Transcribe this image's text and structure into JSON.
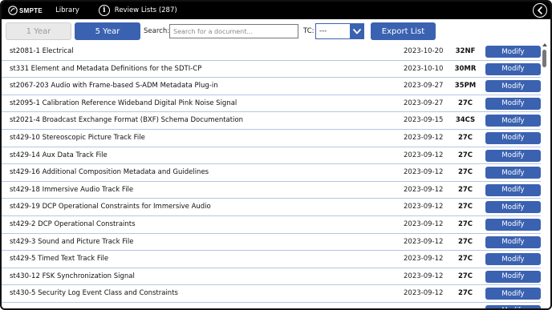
{
  "topbar": {
    "logo_text": "SMPTE",
    "library_label": "Library",
    "info_icon_glyph": "i",
    "review_lists_label": "Review Lists (287)"
  },
  "toolbar": {
    "one_year_label": "1 Year",
    "five_year_label": "5 Year",
    "search_label": "Search:",
    "search_placeholder": "Search for a document...",
    "tc_label": "TC:",
    "tc_value": "---",
    "export_label": "Export List"
  },
  "colors": {
    "accent": "#3b62b1",
    "topbar": "#000000",
    "row_divider": "#b7c6e3"
  },
  "icons": {
    "logo": "smpte-logo-icon",
    "info": "info-icon",
    "back": "chevron-left-icon",
    "dropdown": "chevron-down-icon"
  },
  "documents": [
    {
      "title": "st2081-1 Electrical",
      "date": "2023-10-20",
      "tc": "32NF",
      "action": "Modify"
    },
    {
      "title": "st331 Element and Metadata Definitions for the SDTI-CP",
      "date": "2023-10-10",
      "tc": "30MR",
      "action": "Modify"
    },
    {
      "title": "st2067-203 Audio with Frame-based S-ADM Metadata Plug-in",
      "date": "2023-09-27",
      "tc": "35PM",
      "action": "Modify"
    },
    {
      "title": "st2095-1 Calibration Reference Wideband Digital Pink Noise Signal",
      "date": "2023-09-27",
      "tc": "27C",
      "action": "Modify"
    },
    {
      "title": "st2021-4 Broadcast Exchange Format (BXF) Schema Documentation",
      "date": "2023-09-15",
      "tc": "34CS",
      "action": "Modify"
    },
    {
      "title": "st429-10 Stereoscopic Picture Track File",
      "date": "2023-09-12",
      "tc": "27C",
      "action": "Modify"
    },
    {
      "title": "st429-14 Aux Data Track File",
      "date": "2023-09-12",
      "tc": "27C",
      "action": "Modify"
    },
    {
      "title": "st429-16 Additional Composition Metadata and Guidelines",
      "date": "2023-09-12",
      "tc": "27C",
      "action": "Modify"
    },
    {
      "title": "st429-18 Immersive Audio Track File",
      "date": "2023-09-12",
      "tc": "27C",
      "action": "Modify"
    },
    {
      "title": "st429-19 DCP Operational Constraints for Immersive Audio",
      "date": "2023-09-12",
      "tc": "27C",
      "action": "Modify"
    },
    {
      "title": "st429-2 DCP Operational Constraints",
      "date": "2023-09-12",
      "tc": "27C",
      "action": "Modify"
    },
    {
      "title": "st429-3 Sound and Picture Track File",
      "date": "2023-09-12",
      "tc": "27C",
      "action": "Modify"
    },
    {
      "title": "st429-5 Timed Text Track File",
      "date": "2023-09-12",
      "tc": "27C",
      "action": "Modify"
    },
    {
      "title": "st430-12 FSK Synchronization Signal",
      "date": "2023-09-12",
      "tc": "27C",
      "action": "Modify"
    },
    {
      "title": "st430-5 Security Log Event Class and Constraints",
      "date": "2023-09-12",
      "tc": "27C",
      "action": "Modify"
    },
    {
      "title": "",
      "date": "",
      "tc": "",
      "action": "Modify"
    }
  ]
}
